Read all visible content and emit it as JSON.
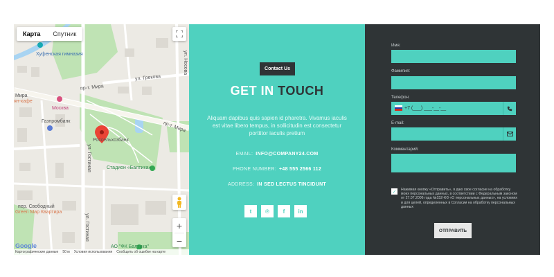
{
  "map": {
    "tab_map": "Карта",
    "tab_satellite": "Спутник",
    "labels": {
      "gymnasium": "Хуфенская гимназия",
      "street_mira_left": "Мира",
      "street_mira_top": "пр-т. Мира",
      "street_grekova": "ул. Грекова",
      "street_mira_right": "пр-т. Мира",
      "street_nosova": "ул. Носова",
      "cafe": "ян-кафе",
      "moskva": "Москва",
      "gazprombank": "Газпромбанк",
      "rosselkhozbank": "Россельхозбанк",
      "stadium": "Стадион «Балтика»",
      "street_gostinaya": "ул. Гостиная",
      "street_gostinaya2": "ул. Гостиная",
      "svobodny": "пер. Свободный",
      "green_map": "Green Map Квартира",
      "fk_baltika": "АО \"ФК Балтика\""
    },
    "attribution": {
      "data": "Картографические данные",
      "scale": "50 м",
      "terms": "Условия использования",
      "report": "Сообщить об ошибке на карте"
    },
    "google": "Google"
  },
  "contact": {
    "badge": "Contact Us",
    "title_light": "GET IN ",
    "title_dark": "TOUCH",
    "description": "Aliquam dapibus quis sapien id pharetra. Vivamus iaculis est vitae libero tempus, in sollicitudin est consectetur porttitor iaculis pretium",
    "email_label": "EMAIL:",
    "email_value": "INFO@COMPANY24.COM",
    "phone_label": "PHONE NUMBER:",
    "phone_value": "+48 555 2566 112",
    "address_label": "ADDRESS:",
    "address_value": "IN SED LECTUS TINCIDUNT",
    "socials": [
      {
        "icon": "twitter-icon",
        "glyph": "t"
      },
      {
        "icon": "pinterest-icon",
        "glyph": "℗"
      },
      {
        "icon": "facebook-icon",
        "glyph": "f"
      },
      {
        "icon": "linkedin-icon",
        "glyph": "in"
      }
    ]
  },
  "form": {
    "name_label": "Имя:",
    "surname_label": "Фамилия:",
    "phone_label": "Телефон:",
    "phone_mask": "+7 (___) ___-__-__",
    "email_label": "E-mail:",
    "comment_label": "Комментарий:",
    "consent": "Нажимая кнопку «Отправить», я даю свое согласие на обработку моих персональных данных, в соответствии с Федеральным законом от 27.07.2006 года №152-ФЗ «О персональных данных», на условиях и для целей, определенных в Согласии на обработку персональных данных",
    "submit": "ОТПРАВИТЬ",
    "colors": {
      "accent": "#4fd1bf",
      "dark": "#2f3436"
    }
  }
}
